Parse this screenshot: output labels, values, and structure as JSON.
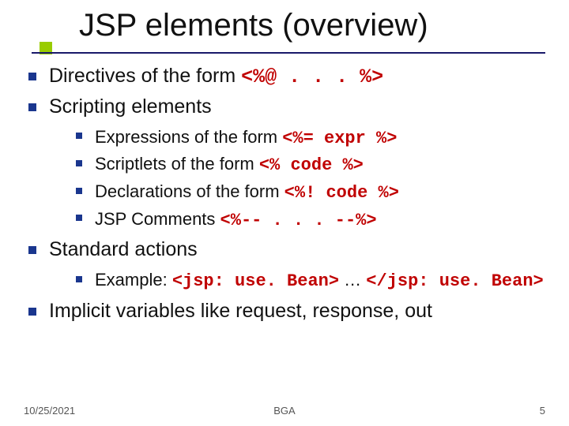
{
  "title": "JSP elements (overview)",
  "bullets": {
    "directives": {
      "text": "Directives of the form ",
      "code": "<%@ . . . %>"
    },
    "scripting": {
      "text": "Scripting elements",
      "items": {
        "expressions": {
          "text": "Expressions of the form ",
          "code": "<%= expr %>"
        },
        "scriptlets": {
          "text": "Scriptlets of the form ",
          "code": "<% code %>"
        },
        "declarations": {
          "text": "Declarations of the form ",
          "code": "<%! code %>"
        },
        "comments": {
          "text": "JSP Comments ",
          "code": "<%-- . . . --%>"
        }
      }
    },
    "standard_actions": {
      "text": "Standard actions",
      "items": {
        "example": {
          "text": "Example: ",
          "code_open": "<jsp: use. Bean>",
          "mid": " … ",
          "code_close": "</jsp: use. Bean>"
        }
      }
    },
    "implicit": {
      "text": "Implicit variables like request, response, out"
    }
  },
  "footer": {
    "date": "10/25/2021",
    "center": "BGA",
    "page": "5"
  }
}
